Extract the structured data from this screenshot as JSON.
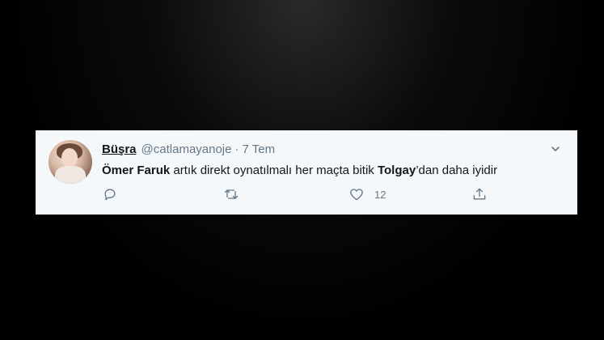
{
  "tweet": {
    "display_name": "Büşra",
    "handle": "@catlamayanoje",
    "separator": "·",
    "date": "7 Tem",
    "text": {
      "part1": "Ömer Faruk",
      "part2": " artık direkt oynatılmalı her maçta bitik ",
      "part3": "Tolgay",
      "part4": "’dan daha iyidir"
    },
    "like_count": "12"
  },
  "icons": {
    "more": "chevron-down-icon",
    "reply": "reply-icon",
    "retweet": "retweet-icon",
    "like": "heart-icon",
    "share": "share-icon"
  },
  "colors": {
    "card_bg": "#f5f8fa",
    "text_primary": "#14171a",
    "text_secondary": "#657786"
  }
}
